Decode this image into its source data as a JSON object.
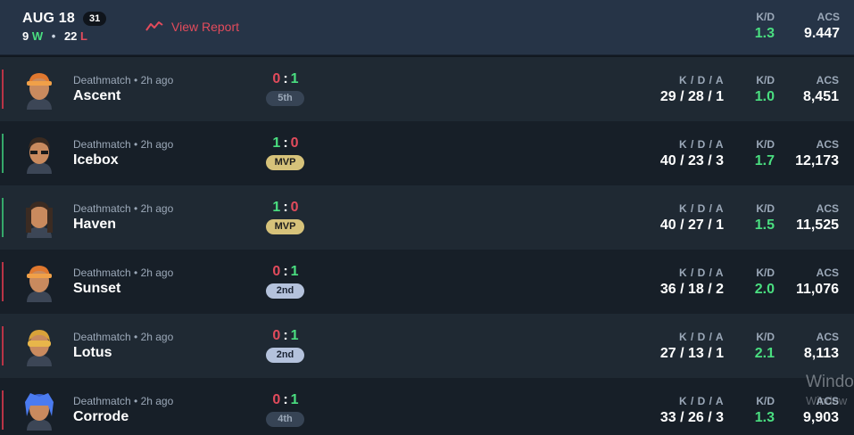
{
  "header": {
    "date": "AUG 18",
    "count": "31",
    "wins": "9",
    "wins_suffix": "W",
    "losses": "22",
    "losses_suffix": "L",
    "view_report": "View Report",
    "kd_label": "K/D",
    "kd_value": "1.3",
    "acs_label": "ACS",
    "acs_value": "9.447"
  },
  "labels": {
    "kda": "K / D / A",
    "kd": "K/D",
    "acs": "ACS"
  },
  "matches": [
    {
      "mode": "Deathmatch • 2h ago",
      "map": "Ascent",
      "score_left": "0",
      "score_right": "1",
      "result": "loss",
      "place": "5th",
      "place_style": "plain",
      "kda": "29 / 28 / 1",
      "kd": "1.0",
      "acs": "8,451",
      "agent": "agent-orange-hair"
    },
    {
      "mode": "Deathmatch • 2h ago",
      "map": "Icebox",
      "score_left": "1",
      "score_right": "0",
      "result": "win",
      "place": "MVP",
      "place_style": "mvp",
      "kda": "40 / 23 / 3",
      "kd": "1.7",
      "acs": "12,173",
      "agent": "agent-glasses"
    },
    {
      "mode": "Deathmatch • 2h ago",
      "map": "Haven",
      "score_left": "1",
      "score_right": "0",
      "result": "win",
      "place": "MVP",
      "place_style": "mvp",
      "kda": "40 / 27 / 1",
      "kd": "1.5",
      "acs": "11,525",
      "agent": "agent-long-hair"
    },
    {
      "mode": "Deathmatch • 2h ago",
      "map": "Sunset",
      "score_left": "0",
      "score_right": "1",
      "result": "loss",
      "place": "2nd",
      "place_style": "second",
      "kda": "36 / 18 / 2",
      "kd": "2.0",
      "acs": "11,076",
      "agent": "agent-orange-hair"
    },
    {
      "mode": "Deathmatch • 2h ago",
      "map": "Lotus",
      "score_left": "0",
      "score_right": "1",
      "result": "loss",
      "place": "2nd",
      "place_style": "second",
      "kda": "27 / 13 / 1",
      "kd": "2.1",
      "acs": "8,113",
      "agent": "agent-goggles"
    },
    {
      "mode": "Deathmatch • 2h ago",
      "map": "Corrode",
      "score_left": "0",
      "score_right": "1",
      "result": "loss",
      "place": "4th",
      "place_style": "plain",
      "kda": "33 / 26 / 3",
      "kd": "1.3",
      "acs": "9,903",
      "agent": "agent-blue-hair"
    }
  ],
  "watermark": {
    "line1": "Windo",
    "line2": "Window"
  },
  "colors": {
    "win": "#4ade80",
    "loss": "#e24b5c",
    "header_bg": "#263447",
    "mvp": "#d6c27a"
  }
}
